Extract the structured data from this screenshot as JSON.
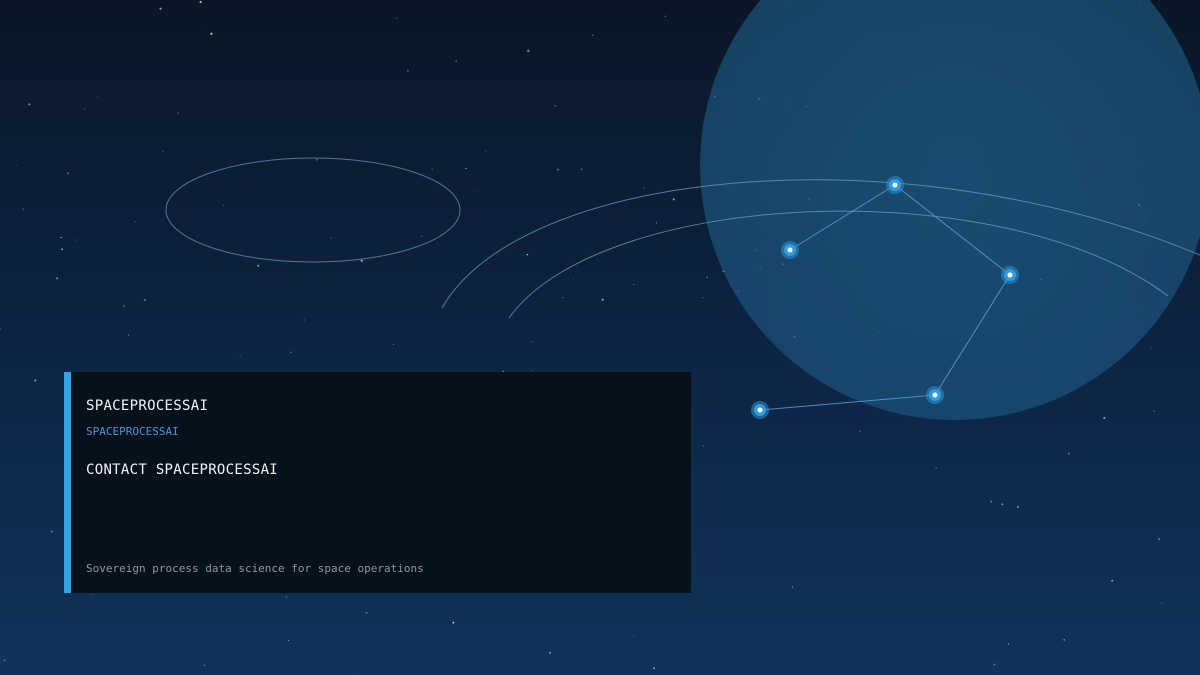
{
  "card": {
    "title": "SPACEPROCESSAI",
    "subtitle": "SPACEPROCESSAI",
    "contact": "CONTACT SPACEPROCESSAI",
    "tagline": "Sovereign process data science for space operations"
  },
  "colors": {
    "accent": "#2ea6e6",
    "subtitle": "#4b96d2",
    "card_background": "#06111b",
    "planet": "#1b4f74"
  }
}
